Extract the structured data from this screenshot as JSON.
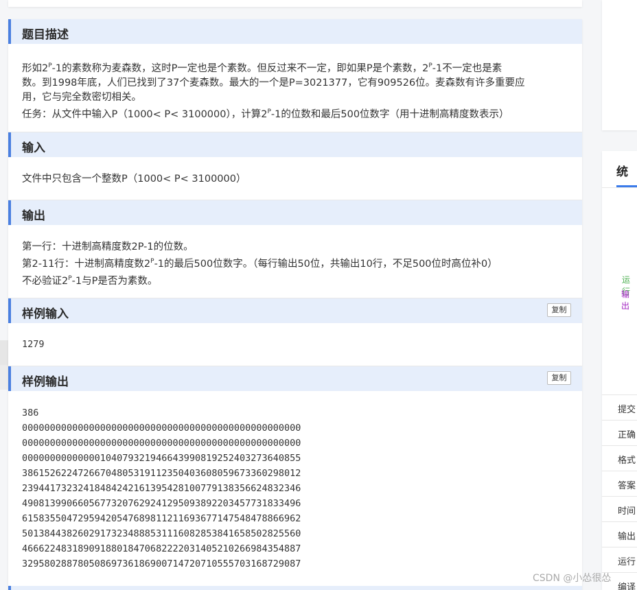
{
  "sections": {
    "description": {
      "title": "题目描述",
      "line1_a": "形如2",
      "line1_sup": "P",
      "line1_b": "-1的素数称为麦森数，这时P一定也是个素数。但反过来不一定，即如果P是个素数，2",
      "line1_sup2": "P",
      "line1_c": "-1不一定也是素",
      "line2": "数。到1998年底，人们已找到了37个麦森数。最大的一个是P=3021377，它有909526位。麦森数有许多重要应",
      "line3": "用，它与完全数密切相关。",
      "line4_a": "任务：从文件中输入P（1000< P< 3100000），计算2",
      "line4_sup": "P",
      "line4_b": "-1的位数和最后500位数字（用十进制高精度数表示）"
    },
    "input": {
      "title": "输入",
      "text": "文件中只包含一个整数P（1000< P< 3100000）"
    },
    "output": {
      "title": "输出",
      "line1": "第一行：十进制高精度数2P-1的位数。",
      "line2_a": "第2-11行：十进制高精度数2",
      "line2_sup": "P",
      "line2_b": "-1的最后500位数字。（每行输出50位，共输出10行，不足500位时高位补0）",
      "line3_a": "不必验证2",
      "line3_sup": "P",
      "line3_b": "-1与P是否为素数。"
    },
    "sample_input": {
      "title": "样例输入",
      "copy_label": "复制",
      "value": "1279"
    },
    "sample_output": {
      "title": "样例输出",
      "copy_label": "复制",
      "lines": [
        "386",
        "00000000000000000000000000000000000000000000000000",
        "00000000000000000000000000000000000000000000000000",
        "00000000000000104079321946643990819252403273640855",
        "38615262247266704805319112350403608059673360298012",
        "23944173232418484242161395428100779138356624832346",
        "49081399066056773207629241295093892203457731833496",
        "61583550472959420547689811211693677147548478866962",
        "50138443826029173234888531116082853841658502825560",
        "46662248318909188018470682222031405210266984354887",
        "32958028878050869736186900714720710555703168729087"
      ]
    }
  },
  "right_panel": {
    "title": "统",
    "green_text": "运行",
    "purple_text": "输出",
    "rows": [
      "提交",
      "正确",
      "格式",
      "答案",
      "时间",
      "输出",
      "运行",
      "编译"
    ]
  },
  "watermark": "CSDN @小怂很怂"
}
